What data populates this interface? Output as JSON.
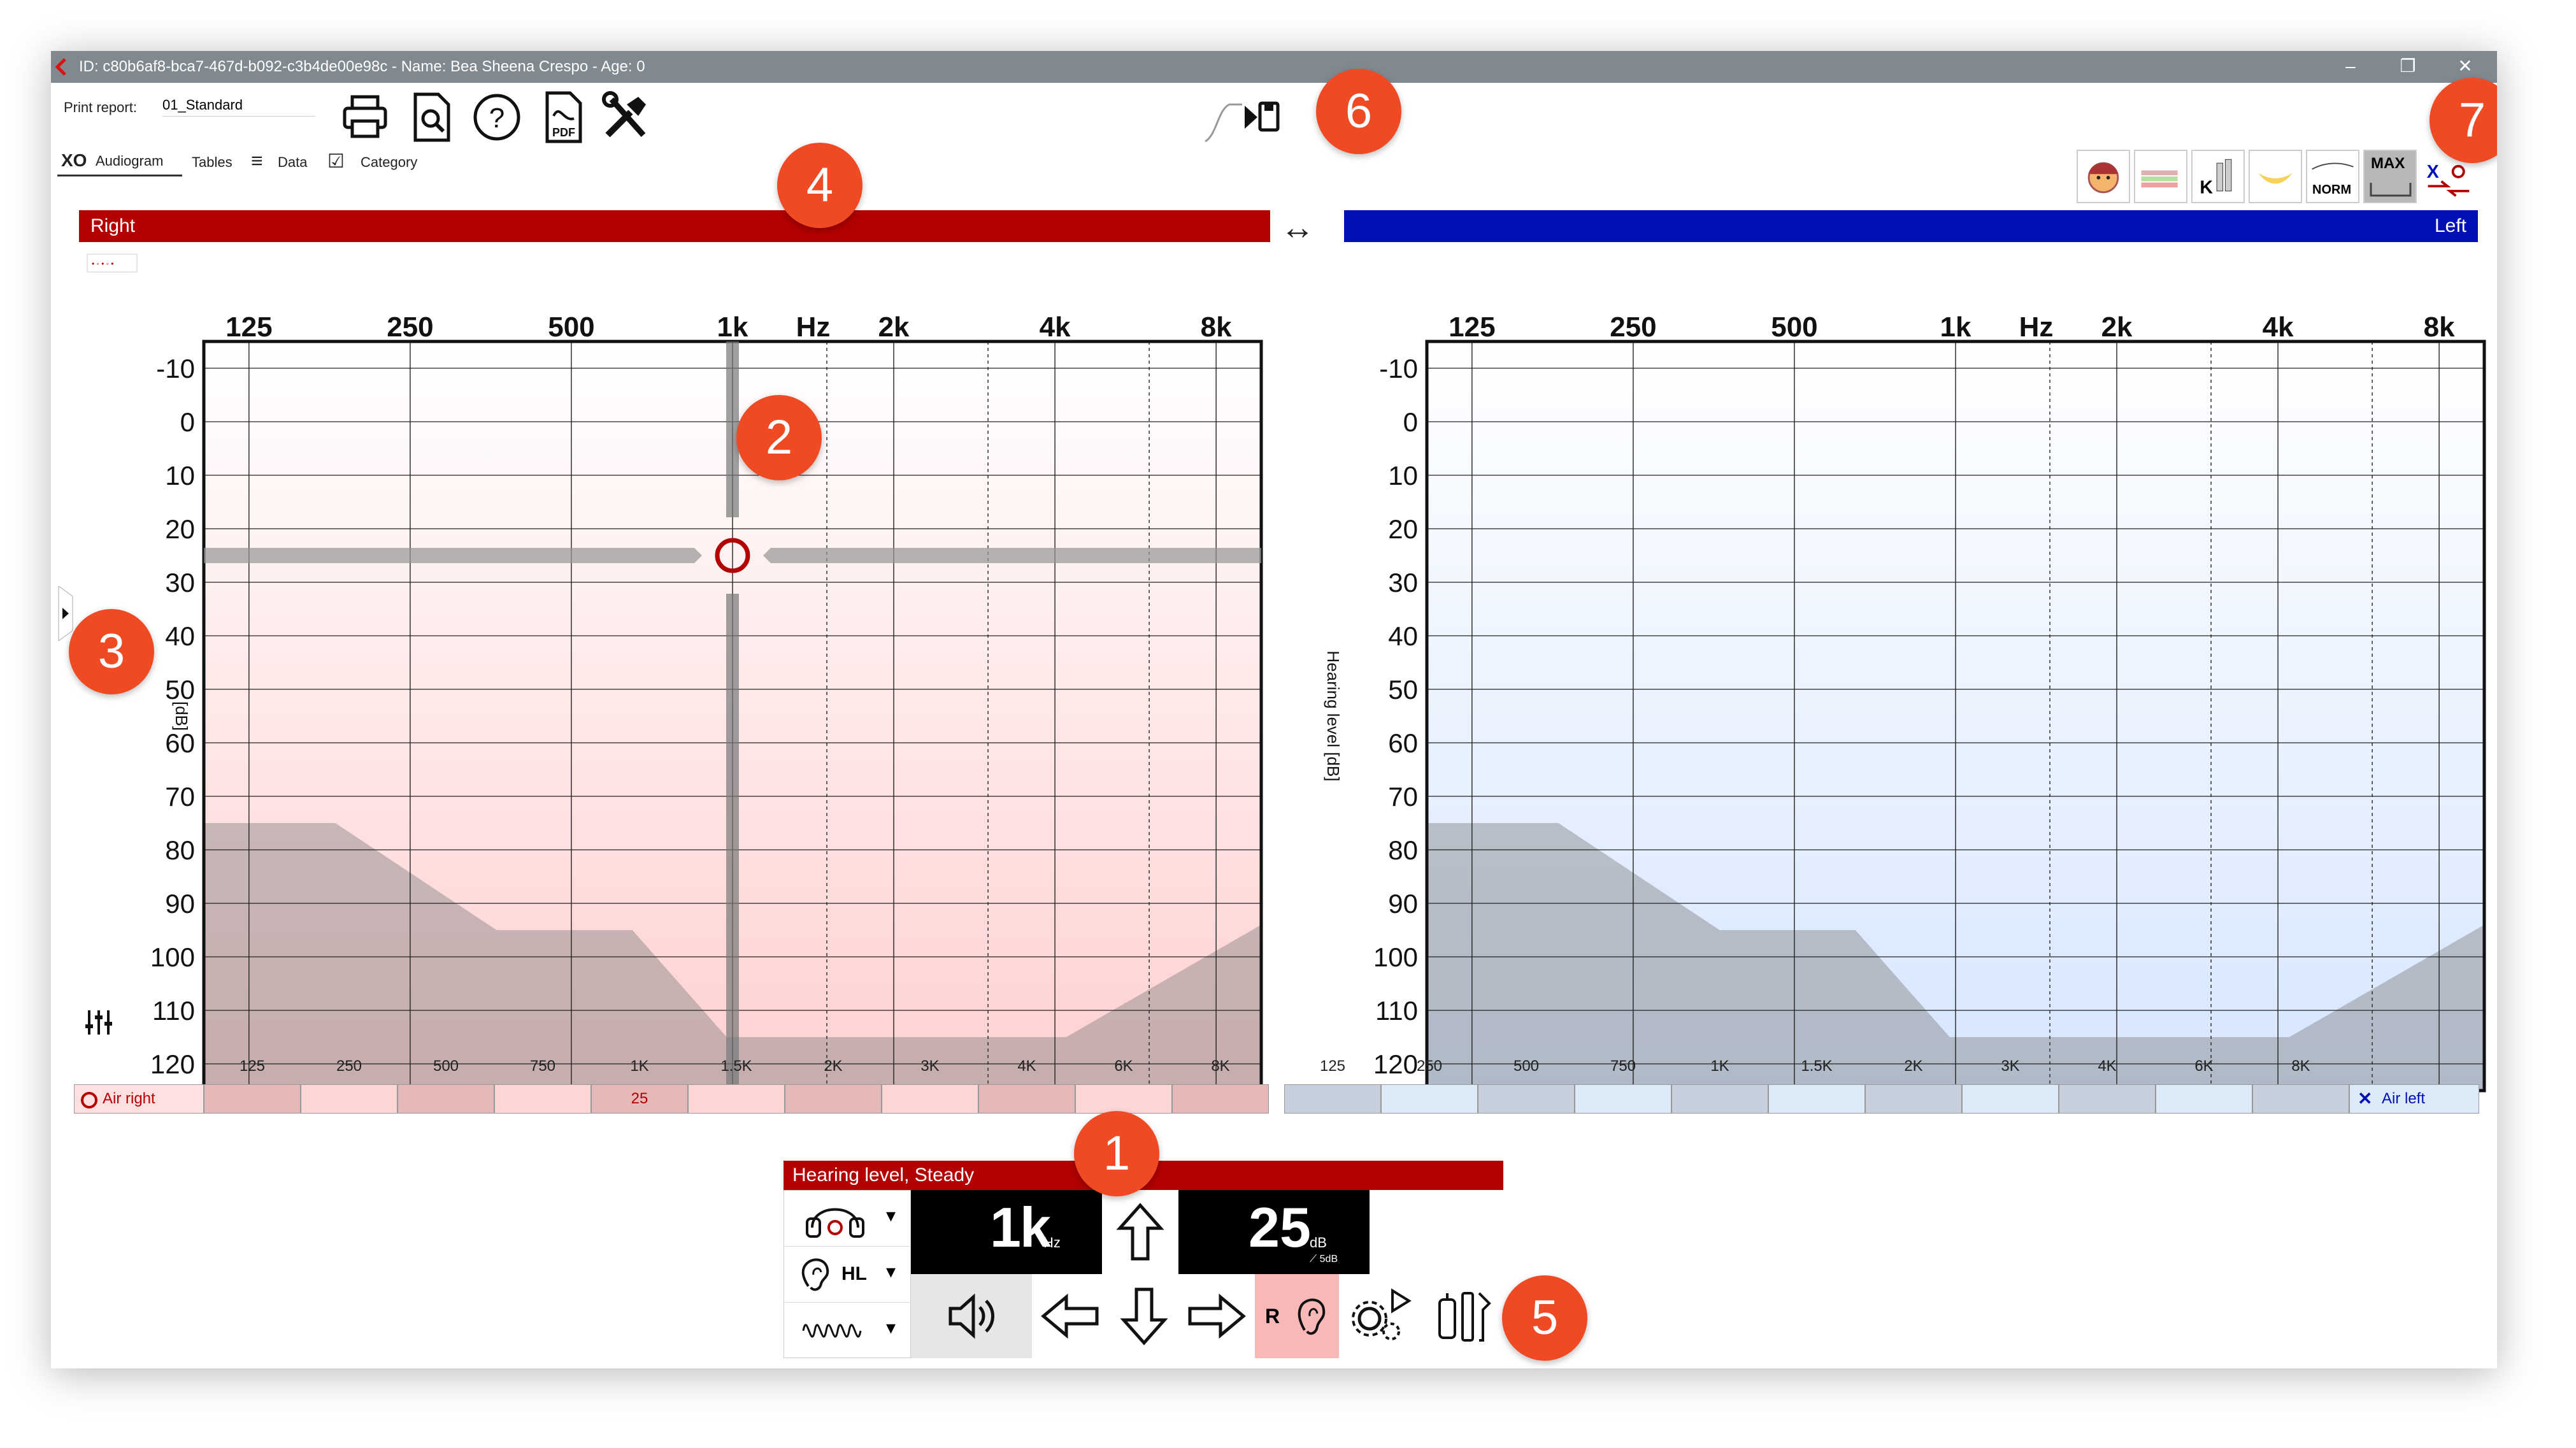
{
  "window": {
    "title": "ID: c80b6af8-bca7-467d-b092-c3b4de00e98c  -  Name: Bea Sheena Crespo - Age: 0",
    "minimize": "–",
    "restore": "❐",
    "close": "✕"
  },
  "toolbar": {
    "print_report_label": "Print report:",
    "print_report_value": "01_Standard",
    "icons": [
      "print-icon",
      "print-preview-icon",
      "help-icon",
      "pdf-icon",
      "tools-icon",
      "play-icon",
      "save-icon"
    ]
  },
  "tabs": [
    {
      "icon": "XO",
      "label": "Audiogram"
    },
    {
      "icon": "",
      "label": "Tables"
    },
    {
      "icon": "≡",
      "label": "Data"
    },
    {
      "icon": "☑",
      "label": "Category"
    }
  ],
  "view_buttons": [
    "face-icon",
    "color-bands-icon",
    "k-scale-icon",
    "speech-banana-icon",
    "NORM",
    "MAX",
    "swap-ear-icon"
  ],
  "view_button_labels": {
    "norm": "NORM",
    "max": "MAX"
  },
  "sides": {
    "right_label": "Right",
    "left_label": "Left",
    "swap_icon": "↔"
  },
  "chart_data": [
    {
      "type": "scatter",
      "ear": "Right",
      "x_ticks_top": [
        "125",
        "250",
        "500",
        "1k",
        "Hz",
        "2k",
        "4k",
        "8k"
      ],
      "y_ticks": [
        "-10",
        "0",
        "10",
        "20",
        "30",
        "40",
        "50",
        "60",
        "70",
        "80",
        "90",
        "100",
        "110",
        "120"
      ],
      "ylabel": "[dB]",
      "ylim": [
        -15,
        125
      ],
      "grid": true,
      "series": [
        {
          "name": "Air right",
          "symbol": "O",
          "color": "#b30000",
          "points": [
            {
              "x": 1000,
              "y": 25
            }
          ]
        }
      ],
      "crosshair": {
        "x": 1000,
        "y": 25
      }
    },
    {
      "type": "scatter",
      "ear": "Left",
      "x_ticks_top": [
        "125",
        "250",
        "500",
        "1k",
        "Hz",
        "2k",
        "4k",
        "8k"
      ],
      "y_ticks": [
        "-10",
        "0",
        "10",
        "20",
        "30",
        "40",
        "50",
        "60",
        "70",
        "80",
        "90",
        "100",
        "110",
        "120"
      ],
      "ylabel": "Hearing level [dB]",
      "ylim": [
        -15,
        125
      ],
      "grid": true,
      "series": [
        {
          "name": "Air left",
          "symbol": "X",
          "color": "#0010b3",
          "points": []
        }
      ]
    }
  ],
  "freq_table": {
    "freqs": [
      "125",
      "250",
      "500",
      "750",
      "1K",
      "1.5K",
      "2K",
      "3K",
      "4K",
      "6K",
      "8K"
    ],
    "right": {
      "label": "Air right",
      "values": [
        "",
        "",
        "",
        "",
        "25",
        "",
        "",
        "",
        "",
        "",
        ""
      ]
    },
    "left": {
      "label": "Air left",
      "values": [
        "",
        "",
        "",
        "",
        "",
        "",
        "",
        "",
        "",
        "",
        ""
      ]
    }
  },
  "control_panel": {
    "header": "Hearing level, Steady",
    "frequency_value": "1k",
    "frequency_unit": "Hz",
    "level_value": "25",
    "level_unit": "dB",
    "step": "⟋ 5dB",
    "hl_label": "HL",
    "ear_label": "R",
    "dropdown_arrow": "▾"
  },
  "badges": [
    "1",
    "2",
    "3",
    "4",
    "5",
    "6",
    "7"
  ]
}
